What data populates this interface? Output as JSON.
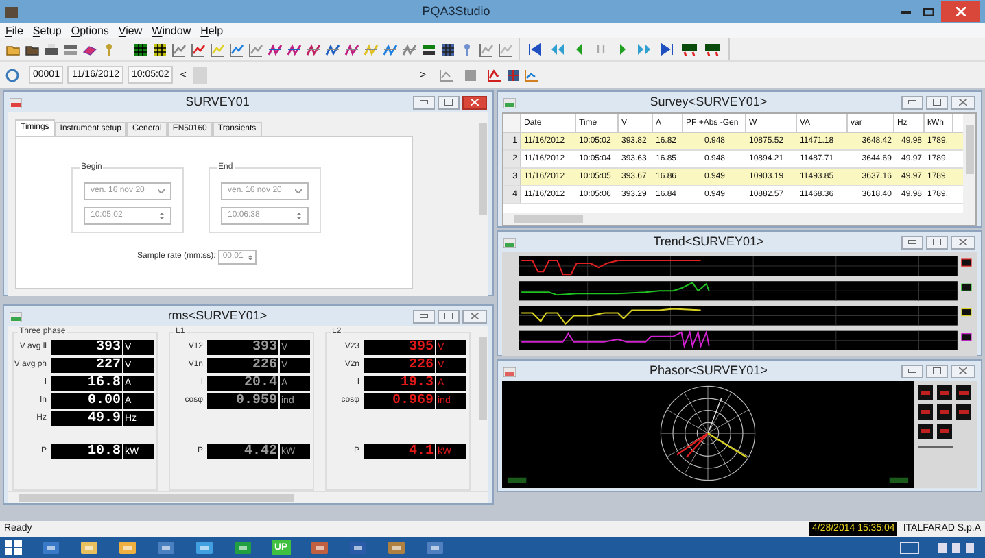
{
  "app": {
    "title": "PQA3Studio"
  },
  "menu": [
    "File",
    "Setup",
    "Options",
    "View",
    "Window",
    "Help"
  ],
  "navigator": {
    "record": "00001",
    "date": "11/16/2012",
    "time": "10:05:02",
    "prev": "<",
    "next": ">"
  },
  "survey_window": {
    "title": "SURVEY01",
    "active": true,
    "tabs": [
      {
        "label": "Timings",
        "selected": true
      },
      {
        "label": "Instrument setup",
        "selected": false
      },
      {
        "label": "General",
        "selected": false
      },
      {
        "label": "EN50160",
        "selected": false
      },
      {
        "label": "Transients",
        "selected": false
      }
    ],
    "begin": {
      "label": "Begin",
      "date": "ven. 16 nov 20",
      "time": "10:05:02"
    },
    "end": {
      "label": "End",
      "date": "ven. 16 nov 20",
      "time": "10:06:38"
    },
    "sample_rate": {
      "label": "Sample rate (mm:ss):",
      "value": "00:01"
    }
  },
  "rms_window": {
    "title": "rms<SURVEY01>",
    "active": false,
    "groups": [
      {
        "title": "Three phase",
        "color": "#ffffff",
        "rows": [
          {
            "label": "V avg ll",
            "value": "393",
            "unit": "V"
          },
          {
            "label": "V avg ph",
            "value": "227",
            "unit": "V"
          },
          {
            "label": "I",
            "value": "16.8",
            "unit": "A"
          },
          {
            "label": "In",
            "value": "0.00",
            "unit": "A"
          },
          {
            "label": "Hz",
            "value": "49.9",
            "unit": "Hz"
          }
        ],
        "power": [
          {
            "label": "P",
            "value": "10.8",
            "unit": "kW"
          }
        ]
      },
      {
        "title": "L1",
        "color": "#9a9a9a",
        "rows": [
          {
            "label": "V12",
            "value": "393",
            "unit": "V"
          },
          {
            "label": "V1n",
            "value": "226",
            "unit": "V"
          },
          {
            "label": "I",
            "value": "20.4",
            "unit": "A"
          },
          {
            "label": "cosφ",
            "value": "0.959",
            "unit": "ind"
          }
        ],
        "power": [
          {
            "label": "P",
            "value": "4.42",
            "unit": "kW"
          }
        ]
      },
      {
        "title": "L2",
        "color": "#e01818",
        "rows": [
          {
            "label": "V23",
            "value": "395",
            "unit": "V"
          },
          {
            "label": "V2n",
            "value": "226",
            "unit": "V"
          },
          {
            "label": "I",
            "value": "19.3",
            "unit": "A"
          },
          {
            "label": "cosφ",
            "value": "0.969",
            "unit": "ind"
          }
        ],
        "power": [
          {
            "label": "P",
            "value": "4.1",
            "unit": "kW"
          }
        ]
      }
    ]
  },
  "survey_table": {
    "title": "Survey<SURVEY01>",
    "active": false,
    "columns": [
      "Date",
      "Time",
      "V",
      "A",
      "PF +Abs -Gen",
      "W",
      "VA",
      "var",
      "Hz",
      "kWh"
    ],
    "rows": [
      {
        "index": "1",
        "cells": [
          "11/16/2012",
          "10:05:02",
          "393.82",
          "16.82",
          "0.948",
          "10875.52",
          "11471.18",
          "3648.42",
          "49.98",
          "1789."
        ]
      },
      {
        "index": "2",
        "cells": [
          "11/16/2012",
          "10:05:04",
          "393.63",
          "16.85",
          "0.948",
          "10894.21",
          "11487.71",
          "3644.69",
          "49.97",
          "1789."
        ]
      },
      {
        "index": "3",
        "cells": [
          "11/16/2012",
          "10:05:05",
          "393.67",
          "16.86",
          "0.949",
          "10903.19",
          "11493.85",
          "3637.16",
          "49.97",
          "1789."
        ]
      },
      {
        "index": "4",
        "cells": [
          "11/16/2012",
          "10:05:06",
          "393.29",
          "16.84",
          "0.949",
          "10882.57",
          "11468.36",
          "3618.40",
          "49.98",
          "1789."
        ]
      }
    ]
  },
  "trend_window": {
    "title": "Trend<SURVEY01>",
    "active": false
  },
  "phasor_window": {
    "title": "Phasor<SURVEY01>",
    "active": false
  },
  "status_bar": {
    "text": "Ready",
    "datetime": "4/28/2014 15:35:04",
    "company": "ITALFARAD S.p.A"
  },
  "taskbar": {
    "app_label": "UP"
  }
}
